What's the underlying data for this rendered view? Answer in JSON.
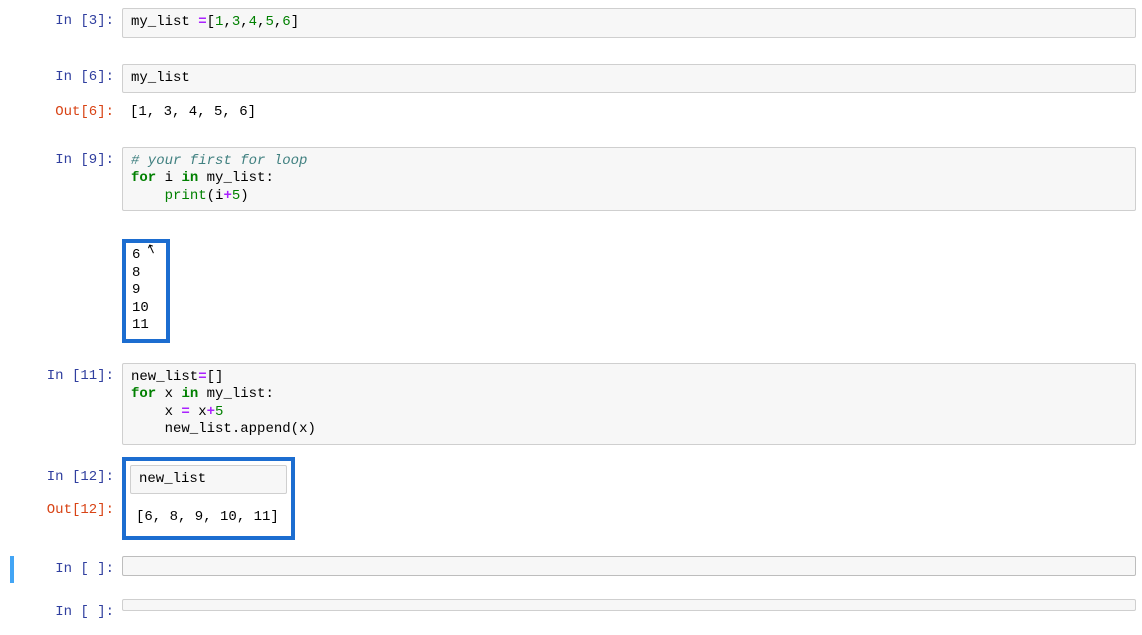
{
  "cells": [
    {
      "prompt_in": "In [3]:",
      "code_html": "my_list <span class='op'>=</span><span class='pn'>[</span><span class='num'>1</span><span class='pn'>,</span><span class='num'>3</span><span class='pn'>,</span><span class='num'>4</span><span class='pn'>,</span><span class='num'>5</span><span class='pn'>,</span><span class='num'>6</span><span class='pn'>]</span>"
    },
    {
      "prompt_in": "In [6]:",
      "code_html": "my_list",
      "prompt_out": "Out[6]:",
      "out_text": "[1, 3, 4, 5, 6]"
    },
    {
      "prompt_in": "In [9]:",
      "code_html": "<span class='cm'># your first for loop</span>\n<span class='kw'>for</span> i <span class='kw'>in</span> my_list<span class='pn'>:</span>\n    <span class='bi'>print</span><span class='pn'>(</span>i<span class='op'>+</span><span class='num'>5</span><span class='pn'>)</span>",
      "stream_out": "6\n8\n9\n10\n11"
    },
    {
      "prompt_in": "In [11]:",
      "code_html": "new_list<span class='op'>=</span><span class='pn'>[]</span>\n<span class='kw'>for</span> x <span class='kw'>in</span> my_list<span class='pn'>:</span>\n    x <span class='op'>=</span> x<span class='op'>+</span><span class='num'>5</span>\n    new_list<span class='pn'>.</span>append<span class='pn'>(</span>x<span class='pn'>)</span>"
    },
    {
      "prompt_in": "In [12]:",
      "code_html": "new_list",
      "prompt_out": "Out[12]:",
      "out_text": "[6, 8, 9, 10, 11]"
    },
    {
      "prompt_in": "In [ ]:",
      "code_html": ""
    },
    {
      "prompt_in": "In [ ]:",
      "code_html": ""
    }
  ],
  "cursor_label": "↖"
}
